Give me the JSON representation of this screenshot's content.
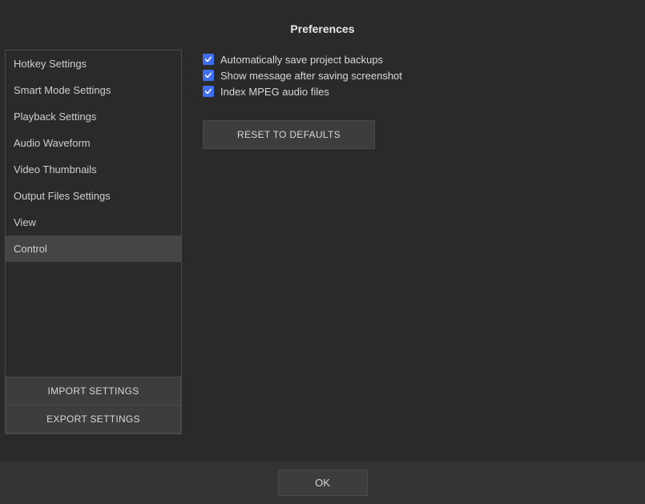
{
  "title": "Preferences",
  "sidebar": {
    "items": [
      {
        "label": "Hotkey Settings",
        "selected": false
      },
      {
        "label": "Smart Mode Settings",
        "selected": false
      },
      {
        "label": "Playback Settings",
        "selected": false
      },
      {
        "label": "Audio Waveform",
        "selected": false
      },
      {
        "label": "Video Thumbnails",
        "selected": false
      },
      {
        "label": "Output Files Settings",
        "selected": false
      },
      {
        "label": "View",
        "selected": false
      },
      {
        "label": "Control",
        "selected": true
      }
    ],
    "import_label": "IMPORT SETTINGS",
    "export_label": "EXPORT SETTINGS"
  },
  "content": {
    "checkboxes": [
      {
        "label": "Automatically save project backups",
        "checked": true
      },
      {
        "label": "Show message after saving screenshot",
        "checked": true
      },
      {
        "label": "Index MPEG audio files",
        "checked": true
      }
    ],
    "reset_label": "RESET TO DEFAULTS"
  },
  "footer": {
    "ok_label": "OK"
  },
  "colors": {
    "accent": "#3f6ff0",
    "bg": "#2a2a2a",
    "panel": "#3d3d3d",
    "border": "#4a4a4a"
  }
}
